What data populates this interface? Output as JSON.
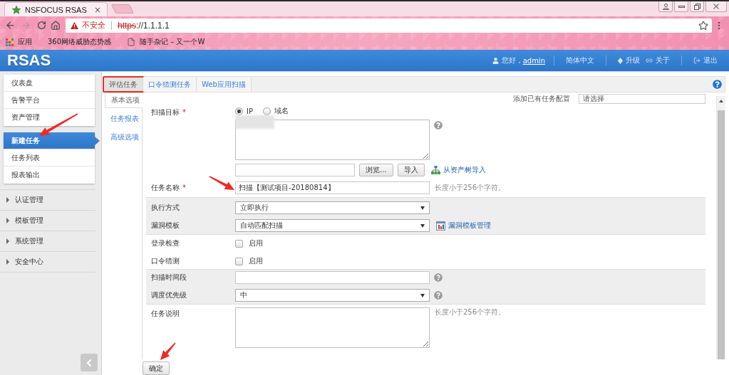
{
  "browser": {
    "tab": {
      "title": "NSFOCUS RSAS",
      "close": "×"
    },
    "address": {
      "warning": "不安全",
      "scheme": "https",
      "rest": "://1.1.1.1"
    },
    "bookmarks": [
      {
        "kind": "apps",
        "label": "应用"
      },
      {
        "kind": "site",
        "label": "360网络威胁态势感"
      },
      {
        "kind": "page",
        "label": "随手杂记 – 又一个W"
      }
    ]
  },
  "header": {
    "logo": "RSAS",
    "greeting": "您好，",
    "user": "admin",
    "language": "简体中文",
    "links": [
      {
        "kind": "upgrade",
        "label": "升级"
      },
      {
        "kind": "about",
        "label": "关于"
      },
      {
        "kind": "logout",
        "label": "退出"
      }
    ]
  },
  "sidebar": {
    "cards": [
      [
        {
          "label": "仪表盘",
          "selected": false
        },
        {
          "label": "告警平台",
          "selected": false
        },
        {
          "label": "资产管理",
          "selected": false
        }
      ],
      [
        {
          "label": "新建任务",
          "selected": true
        },
        {
          "label": "任务列表",
          "selected": false
        },
        {
          "label": "报表输出",
          "selected": false
        }
      ]
    ],
    "sections": [
      {
        "label": "认证管理",
        "expanded": false
      },
      {
        "label": "模板管理",
        "expanded": false
      },
      {
        "label": "系统管理",
        "expanded": false
      },
      {
        "label": "安全中心",
        "expanded": false
      }
    ]
  },
  "tabs": [
    {
      "label": "评估任务",
      "selected": true,
      "highlighted": true
    },
    {
      "label": "口令猜测任务",
      "selected": false,
      "highlighted": false
    },
    {
      "label": "Web应用扫描",
      "selected": false,
      "highlighted": false
    }
  ],
  "subtabs": [
    {
      "label": "基本选项",
      "selected": true
    },
    {
      "label": "任务报表",
      "selected": false
    },
    {
      "label": "高级选项",
      "selected": false
    }
  ],
  "form": {
    "preset": {
      "label": "添加已有任务配置",
      "value": "请选择"
    },
    "groups": [
      {
        "shaded": false,
        "rows": [
          {
            "label": "扫描目标",
            "required_mark": "*",
            "lines": [
              [
                {
                  "kind": "radios",
                  "options": [
                    {
                      "label": "IP",
                      "selected": true
                    },
                    {
                      "label": "域名",
                      "selected": false
                    }
                  ]
                }
              ],
              [
                {
                  "kind": "textarea",
                  "blurred": true
                },
                {
                  "kind": "help"
                }
              ],
              [
                {
                  "kind": "input"
                },
                {
                  "kind": "button",
                  "label": "浏览..."
                },
                {
                  "kind": "button",
                  "label": "导入"
                },
                {
                  "kind": "treelink",
                  "label": "从资产树导入"
                }
              ]
            ]
          },
          {
            "label": "任务名称",
            "required_mark": "*",
            "lines": [
              [
                {
                  "kind": "input",
                  "value": "扫描【测试项目-20180814】"
                },
                {
                  "kind": "hint",
                  "text": "长度小于256个字符。"
                }
              ]
            ]
          }
        ]
      },
      {
        "shaded": true,
        "rows": [
          {
            "label": "执行方式",
            "lines": [
              [
                {
                  "kind": "select",
                  "value": "立即执行"
                }
              ]
            ]
          },
          {
            "label": "漏洞模板",
            "lines": [
              [
                {
                  "kind": "select",
                  "value": "自动匹配扫描"
                },
                {
                  "kind": "templatelink",
                  "label": "漏洞模板管理"
                }
              ]
            ]
          }
        ]
      },
      {
        "shaded": false,
        "rows": [
          {
            "label": "登录检查",
            "lines": [
              [
                {
                  "kind": "checkbox",
                  "label": "启用",
                  "checked": false
                }
              ]
            ]
          },
          {
            "label": "口令猜测",
            "lines": [
              [
                {
                  "kind": "checkbox",
                  "label": "启用",
                  "checked": false
                }
              ]
            ]
          }
        ]
      },
      {
        "shaded": true,
        "rows": [
          {
            "label": "扫描时间段",
            "lines": [
              [
                {
                  "kind": "input"
                },
                {
                  "kind": "help"
                }
              ]
            ]
          },
          {
            "label": "调度优先级",
            "lines": [
              [
                {
                  "kind": "select",
                  "value": "中"
                },
                {
                  "kind": "help"
                }
              ]
            ]
          }
        ]
      },
      {
        "shaded": false,
        "rows": [
          {
            "label": "任务说明",
            "lines": [
              [
                {
                  "kind": "textarea",
                  "blurred": false
                },
                {
                  "kind": "hint",
                  "text": "长度小于256个字符。"
                }
              ]
            ]
          }
        ]
      }
    ],
    "submit": "确定"
  }
}
